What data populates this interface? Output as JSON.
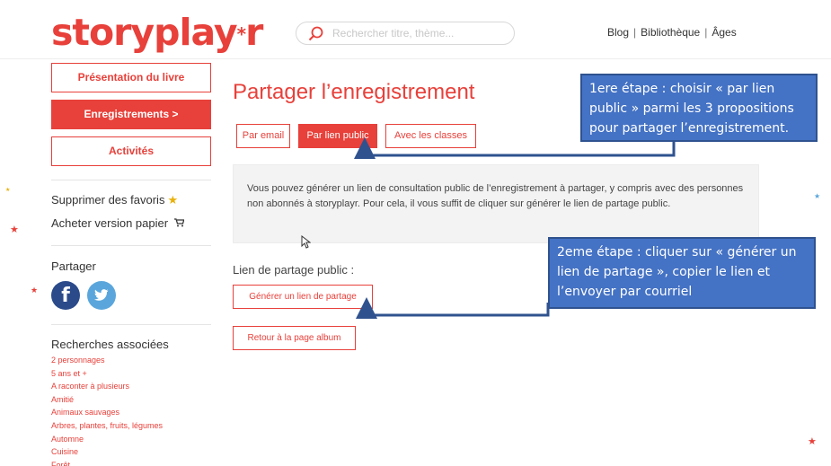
{
  "header": {
    "logo_part1": "story",
    "logo_part2": "play",
    "logo_star": "*",
    "logo_part3": "r",
    "search_placeholder": "Rechercher titre, thème...",
    "nav": [
      "Blog",
      "Bibliothèque",
      "Âges"
    ],
    "nav_separator": "|"
  },
  "sidebar": {
    "buttons": [
      "Présentation du livre",
      "Enregistrements >",
      "Activités"
    ],
    "links": [
      "Supprimer des favoris",
      "Acheter version papier"
    ],
    "favoris_icon": "★",
    "cart_icon": "🛒",
    "share_label": "Partager",
    "facebook_letter": "f",
    "related_title": "Recherches associées",
    "related_items": [
      "2 personnages",
      "5 ans et +",
      "A raconter à plusieurs",
      "Amitié",
      "Animaux sauvages",
      "Arbres, plantes, fruits, légumes",
      "Automne",
      "Cuisine",
      "Forêt"
    ]
  },
  "main": {
    "title": "Partager l’enregistrement",
    "tabs": [
      "Par email",
      "Par lien public",
      "Avec les classes"
    ],
    "active_tab": 1,
    "info_text": "Vous pouvez générer un lien de consultation public de l’enregistrement à partager, y compris avec des personnes non abonnés à storyplayr. Pour cela, il vous suffit de cliquer sur générer le lien de partage public.",
    "link_label": "Lien de partage public :",
    "generate_button": "Générer un lien de partage",
    "back_button": "Retour à la page album"
  },
  "annotations": {
    "step1": "1ere étape :  choisir « par lien public » parmi les 3 propositions pour partager l’enregistrement.",
    "step2": "2eme étape : cliquer sur « générer un lien de partage », copier le lien et l’envoyer par courriel"
  },
  "colors": {
    "brand_red": "#e8403a",
    "callout_blue": "#4472c4",
    "facebook": "#2a4a8a",
    "twitter": "#5aa6dc"
  },
  "icons": [
    "search-icon",
    "star-icon",
    "cart-icon",
    "facebook-icon",
    "twitter-icon",
    "cursor-icon"
  ]
}
